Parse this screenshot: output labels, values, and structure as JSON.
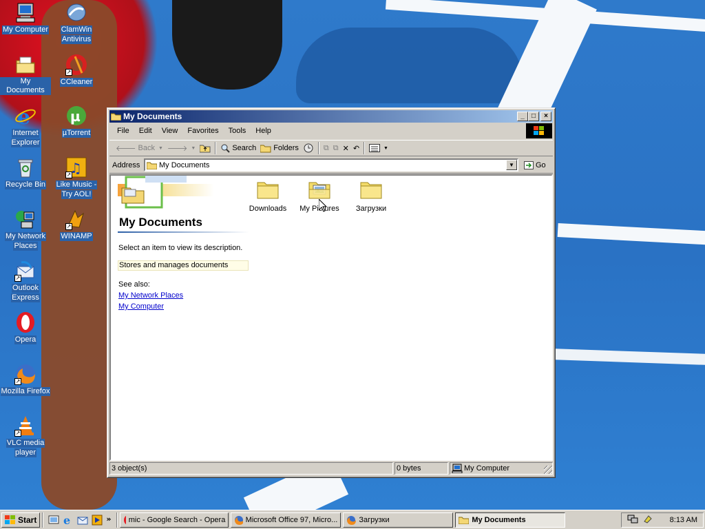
{
  "desktop": {
    "icons": [
      {
        "label_lines": [
          "My Computer"
        ],
        "icon": "computer-icon"
      },
      {
        "label_lines": [
          "ClamWin",
          "Antivirus"
        ],
        "icon": "clamwin-icon"
      },
      {
        "label_lines": [
          "My Documents"
        ],
        "icon": "documents-folder-icon"
      },
      {
        "label_lines": [
          "CCleaner"
        ],
        "icon": "ccleaner-icon"
      },
      {
        "label_lines": [
          "Internet",
          "Explorer"
        ],
        "icon": "internet-explorer-icon"
      },
      {
        "label_lines": [
          "µTorrent"
        ],
        "icon": "utorrent-icon"
      },
      {
        "label_lines": [
          "Recycle Bin"
        ],
        "icon": "recycle-bin-icon"
      },
      {
        "label_lines": [
          "Like Music -",
          "Try AOL!"
        ],
        "icon": "aol-music-icon"
      },
      {
        "label_lines": [
          "My Network",
          "Places"
        ],
        "icon": "network-places-icon"
      },
      {
        "label_lines": [
          "WINAMP"
        ],
        "icon": "winamp-icon"
      },
      {
        "label_lines": [
          "Outlook",
          "Express"
        ],
        "icon": "outlook-express-icon"
      },
      {
        "label_lines": [
          "Opera"
        ],
        "icon": "opera-icon"
      },
      {
        "label_lines": [
          "Mozilla Firefox"
        ],
        "icon": "firefox-icon"
      },
      {
        "label_lines": [
          "VLC media",
          "player"
        ],
        "icon": "vlc-icon"
      }
    ]
  },
  "window": {
    "title": "My Documents",
    "menu": [
      "File",
      "Edit",
      "View",
      "Favorites",
      "Tools",
      "Help"
    ],
    "toolbar": {
      "back_label": "Back",
      "search_label": "Search",
      "folders_label": "Folders"
    },
    "address": {
      "label": "Address",
      "value": "My Documents",
      "go_label": "Go"
    },
    "side_panel": {
      "title": "My Documents",
      "prompt": "Select an item to view its description.",
      "description": "Stores and manages documents",
      "see_also_label": "See also:",
      "links": [
        "My Network Places",
        "My Computer"
      ]
    },
    "items": [
      {
        "label": "Downloads",
        "icon": "folder-icon"
      },
      {
        "label": "My Pictures",
        "icon": "pictures-folder-icon"
      },
      {
        "label": "Загрузки",
        "icon": "folder-icon"
      }
    ],
    "status": {
      "objects": "3 object(s)",
      "size": "0 bytes",
      "zone": "My Computer"
    }
  },
  "taskbar": {
    "start_label": "Start",
    "tasks": [
      {
        "label": "mic - Google Search - Opera",
        "icon": "opera-icon",
        "active": false
      },
      {
        "label": "Microsoft Office 97, Micro...",
        "icon": "firefox-icon",
        "active": false
      },
      {
        "label": "Загрузки",
        "icon": "firefox-icon",
        "active": false
      },
      {
        "label": "My Documents",
        "icon": "folder-icon",
        "active": true
      }
    ],
    "clock": "8:13 AM"
  },
  "colors": {
    "titlebar_start": "#0a246a",
    "titlebar_end": "#a6caf0",
    "link": "#0000cc",
    "face": "#d4d0c8"
  }
}
